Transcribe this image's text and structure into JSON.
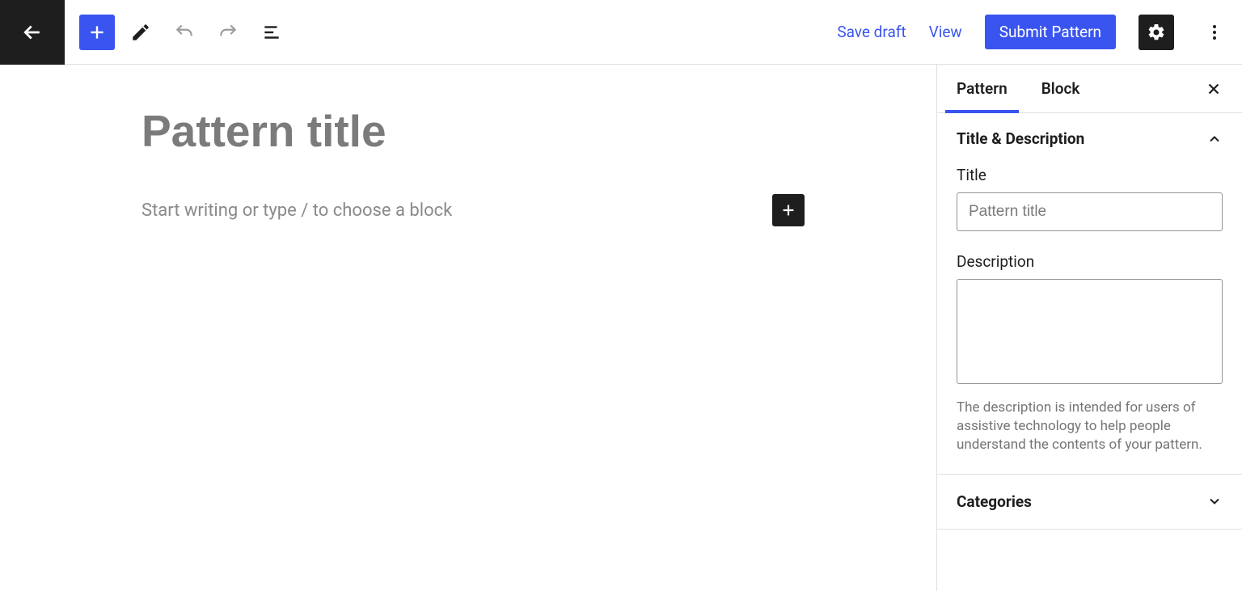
{
  "toolbar": {
    "save_draft": "Save draft",
    "view": "View",
    "submit": "Submit Pattern"
  },
  "canvas": {
    "title_placeholder": "Pattern title",
    "paragraph_placeholder": "Start writing or type / to choose a block"
  },
  "sidebar": {
    "tabs": {
      "pattern": "Pattern",
      "block": "Block"
    },
    "panels": {
      "title_desc": {
        "header": "Title & Description",
        "title_label": "Title",
        "title_placeholder": "Pattern title",
        "description_label": "Description",
        "description_help": "The description is intended for users of assistive technology to help people understand the contents of your pattern."
      },
      "categories": {
        "header": "Categories"
      }
    }
  }
}
